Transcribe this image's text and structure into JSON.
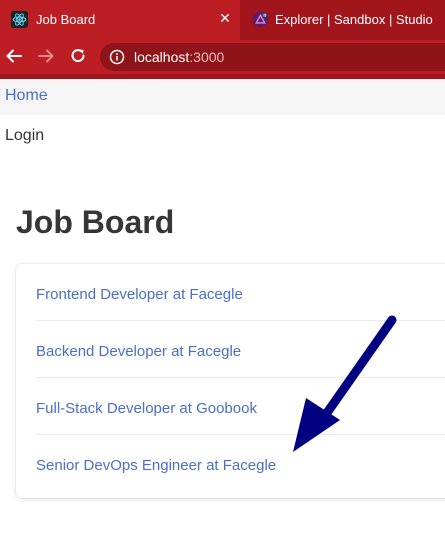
{
  "browser": {
    "tabs": [
      {
        "title": "Job Board",
        "icon": "react-icon",
        "active": true
      },
      {
        "title": "Explorer | Sandbox | Studio",
        "icon": "studio-icon",
        "active": false
      }
    ],
    "close_glyph": "✕",
    "url_host": "localhost",
    "url_port": ":3000"
  },
  "nav": {
    "home_label": "Home",
    "login_label": "Login"
  },
  "page": {
    "title": "Job Board",
    "jobs": [
      "Frontend Developer at Facegle",
      "Backend Developer at Facegle",
      "Full-Stack Developer at Goobook",
      "Senior DevOps Engineer at Facegle"
    ]
  },
  "annotation": {
    "arrow_color": "#000080",
    "arrow_icon": "arrow-pointer-icon"
  }
}
